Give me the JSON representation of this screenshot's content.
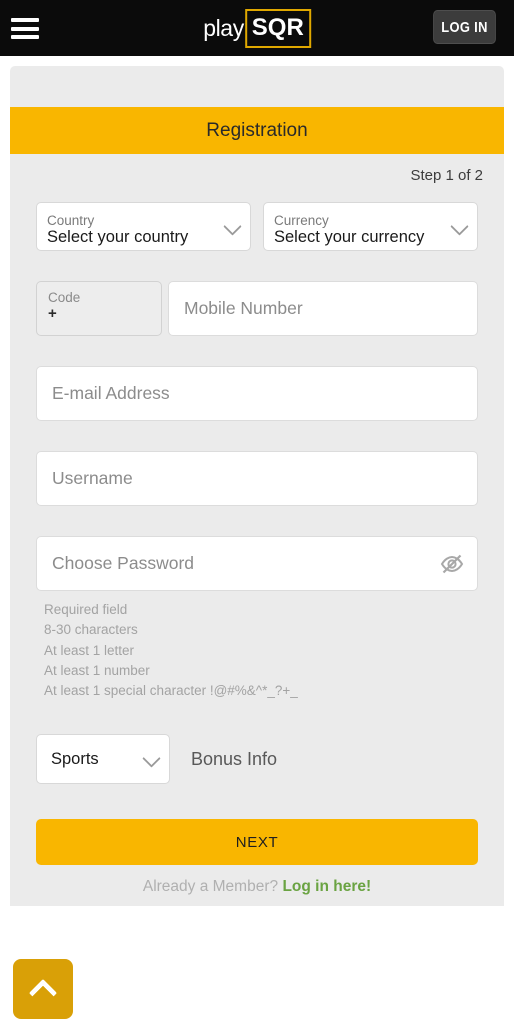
{
  "header": {
    "menu_icon": "hamburger-menu-icon",
    "logo_play": "play",
    "logo_sqr": "SQR",
    "login_label": "LOG IN"
  },
  "card": {
    "title": "Registration",
    "step": "Step 1 of 2"
  },
  "form": {
    "country": {
      "label": "Country",
      "value": "Select your country",
      "chevron": "chevron-down-icon"
    },
    "currency": {
      "label": "Currency",
      "value": "Select your currency",
      "chevron": "chevron-down-icon"
    },
    "code": {
      "label": "Code",
      "value": "+"
    },
    "mobile": {
      "placeholder": "Mobile Number"
    },
    "email": {
      "placeholder": "E-mail Address"
    },
    "username": {
      "placeholder": "Username"
    },
    "password": {
      "placeholder": "Choose Password",
      "toggle_icon": "eye-slash-icon"
    },
    "password_rules": [
      "Required field",
      "8-30 characters",
      "At least 1 letter",
      "At least 1 number",
      "At least 1 special character !@#%&^*_?+_"
    ],
    "bonus": {
      "selected": "Sports",
      "chevron": "chevron-down-icon",
      "info_label": "Bonus Info"
    },
    "next_label": "NEXT",
    "member_prompt": "Already a Member?",
    "member_link": "Log in here!"
  },
  "scroll_top": {
    "icon": "chevron-up-icon"
  },
  "colors": {
    "brand_gold": "#f9b600",
    "scroll_gold": "#d9a007",
    "header_black": "#0b0b0b",
    "card_grey": "#ebebeb",
    "link_green": "#6aa342",
    "login_grey": "#3c3c3c"
  }
}
